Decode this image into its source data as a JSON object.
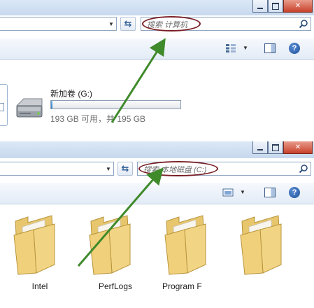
{
  "top_window": {
    "search_placeholder": "搜索 计算机",
    "drive": {
      "name": "新加卷 (G:)",
      "free_text": "193 GB 可用，共 195 GB",
      "used_fraction": 0.01
    }
  },
  "bottom_window": {
    "search_placeholder": "搜索 本地磁盘 (C:)",
    "folders": [
      {
        "label": "Intel"
      },
      {
        "label": "PerfLogs"
      },
      {
        "label": "Program F"
      },
      {
        "label": ""
      }
    ]
  },
  "icons": {
    "window_controls": [
      "minimize-icon",
      "maximize-icon",
      "close-icon"
    ],
    "refresh": "refresh-icon",
    "search": "search-icon",
    "view": "view-options-icon",
    "pane": "preview-pane-icon",
    "help": "help-icon",
    "drive": "hard-drive-icon",
    "folder": "folder-icon"
  },
  "colors": {
    "annotation_oval": "#7a1f25",
    "annotation_arrow": "#3f8a2b",
    "capacity_bar": "#2e7fc7",
    "folder": "#f2d584"
  }
}
